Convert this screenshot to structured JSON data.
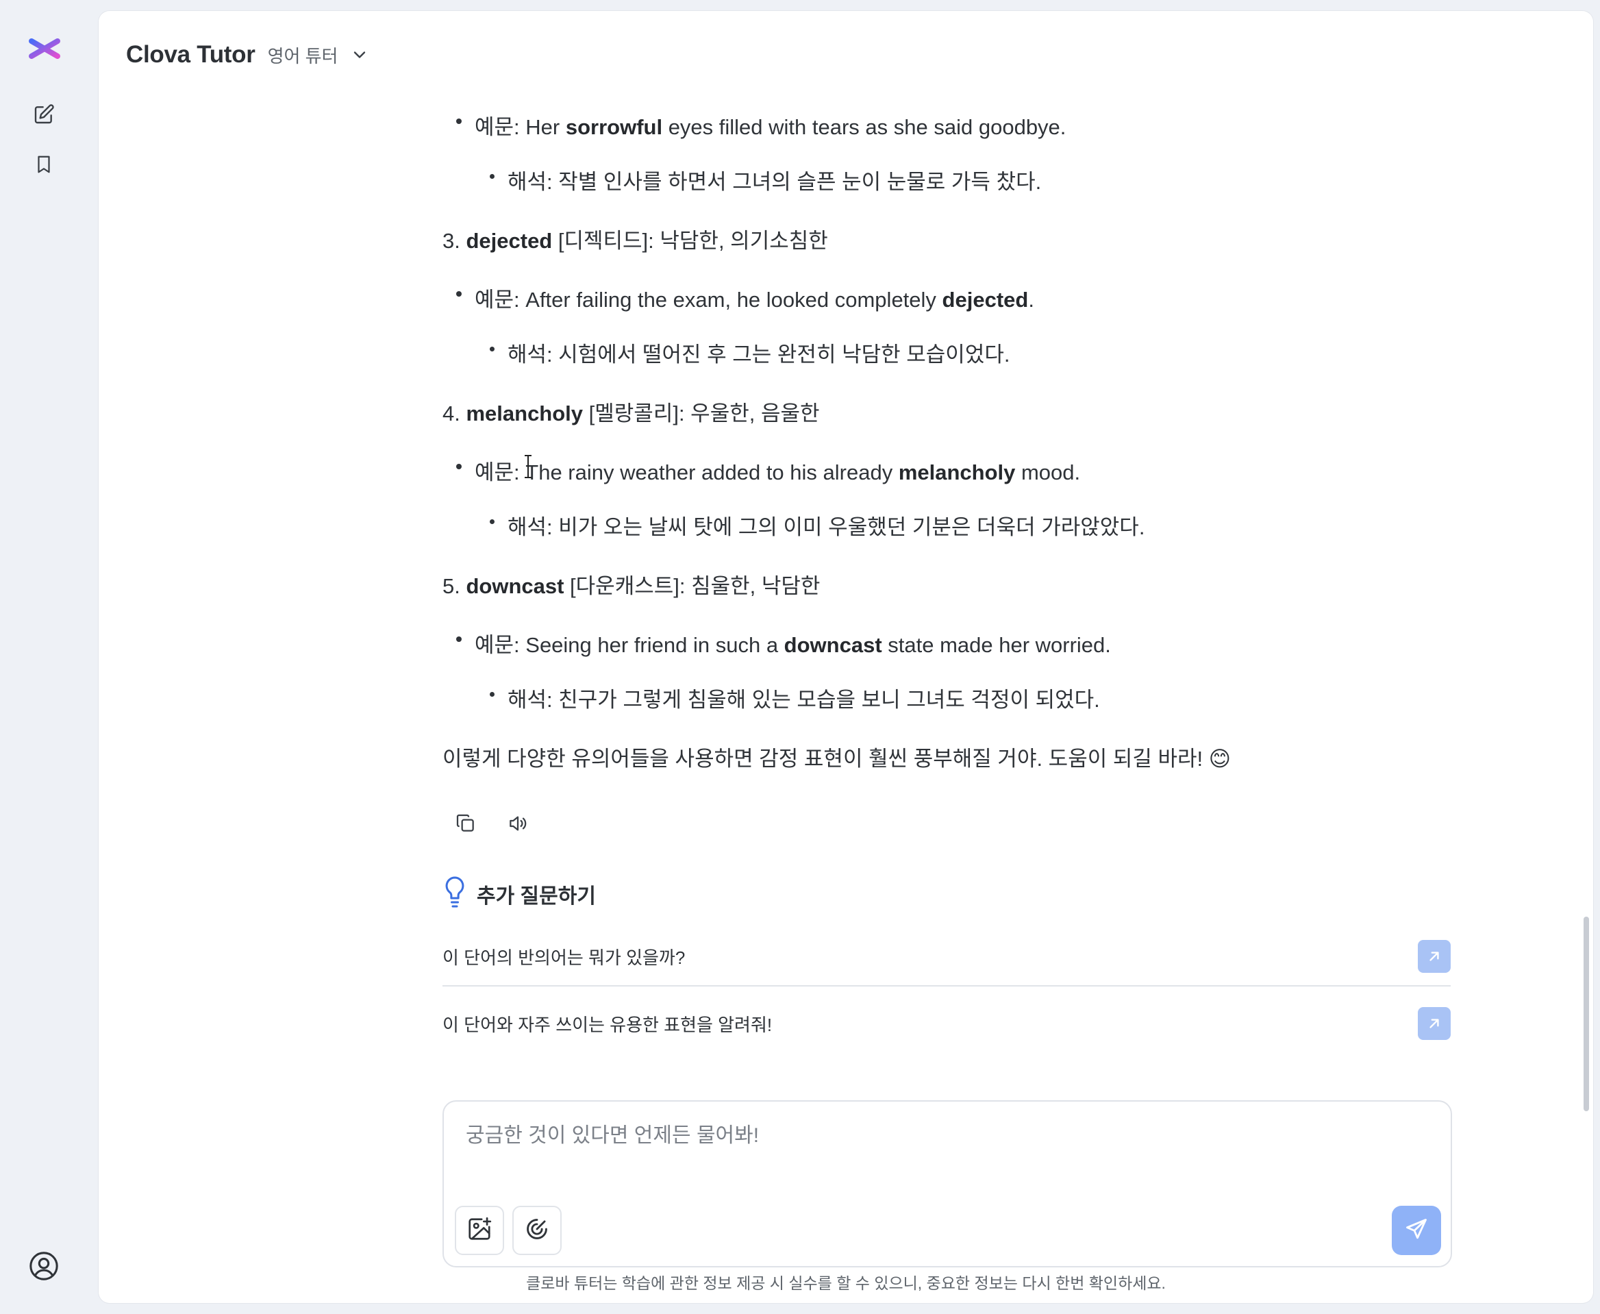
{
  "header": {
    "app_title": "Clova Tutor",
    "tutor_selector": "영어 튜터"
  },
  "sidebar": {
    "icons": [
      "logo-icon",
      "new-chat-icon",
      "bookmark-icon",
      "account-icon"
    ]
  },
  "message": {
    "items": [
      {
        "type": "example",
        "prefix": "예문: Her ",
        "bold": "sorrowful",
        "suffix": " eyes filled with tears as she said goodbye."
      },
      {
        "type": "translation",
        "text": "해석: 작별 인사를 하면서 그녀의 슬픈 눈이 눈물로 가득 찼다."
      },
      {
        "type": "heading",
        "number": "3. ",
        "bold": "dejected",
        "suffix": " [디젝티드]: 낙담한, 의기소침한"
      },
      {
        "type": "example",
        "prefix": "예문: After failing the exam, he looked completely ",
        "bold": "dejected",
        "suffix": "."
      },
      {
        "type": "translation",
        "text": "해석: 시험에서 떨어진 후 그는 완전히 낙담한 모습이었다."
      },
      {
        "type": "heading",
        "number": "4. ",
        "bold": "melancholy",
        "suffix": " [멜랑콜리]: 우울한, 음울한"
      },
      {
        "type": "example",
        "prefix": "예문: The rainy weather added to his already ",
        "bold": "melancholy",
        "suffix": " mood."
      },
      {
        "type": "translation",
        "text": "해석: 비가 오는 날씨 탓에 그의 이미 우울했던 기분은 더욱더 가라앉았다."
      },
      {
        "type": "heading",
        "number": "5. ",
        "bold": "downcast",
        "suffix": " [다운캐스트]: 침울한, 낙담한"
      },
      {
        "type": "example",
        "prefix": "예문: Seeing her friend in such a ",
        "bold": "downcast",
        "suffix": " state made her worried."
      },
      {
        "type": "translation",
        "text": "해석: 친구가 그렇게 침울해 있는 모습을 보니 그녀도 걱정이 되었다."
      }
    ],
    "closing": "이렇게 다양한 유의어들을 사용하면 감정 표현이 훨씬 풍부해질 거야. 도움이 되길 바라! 😊"
  },
  "followup": {
    "title": "추가 질문하기",
    "questions": [
      "이 단어의 반의어는 뭐가 있을까?",
      "이 단어와 자주 쓰이는 유용한 표현을 알려줘!"
    ]
  },
  "composer": {
    "placeholder": "궁금한 것이 있다면 언제든 물어봐!"
  },
  "footer": {
    "disclaimer": "클로바 튜터는 학습에 관한 정보 제공 시 실수를 할 수 있으니, 중요한 정보는 다시 한번 확인하세요."
  },
  "colors": {
    "accent": "#8fb2f7",
    "logo_gradient": [
      "#4a6cf7",
      "#e04fd1"
    ]
  }
}
